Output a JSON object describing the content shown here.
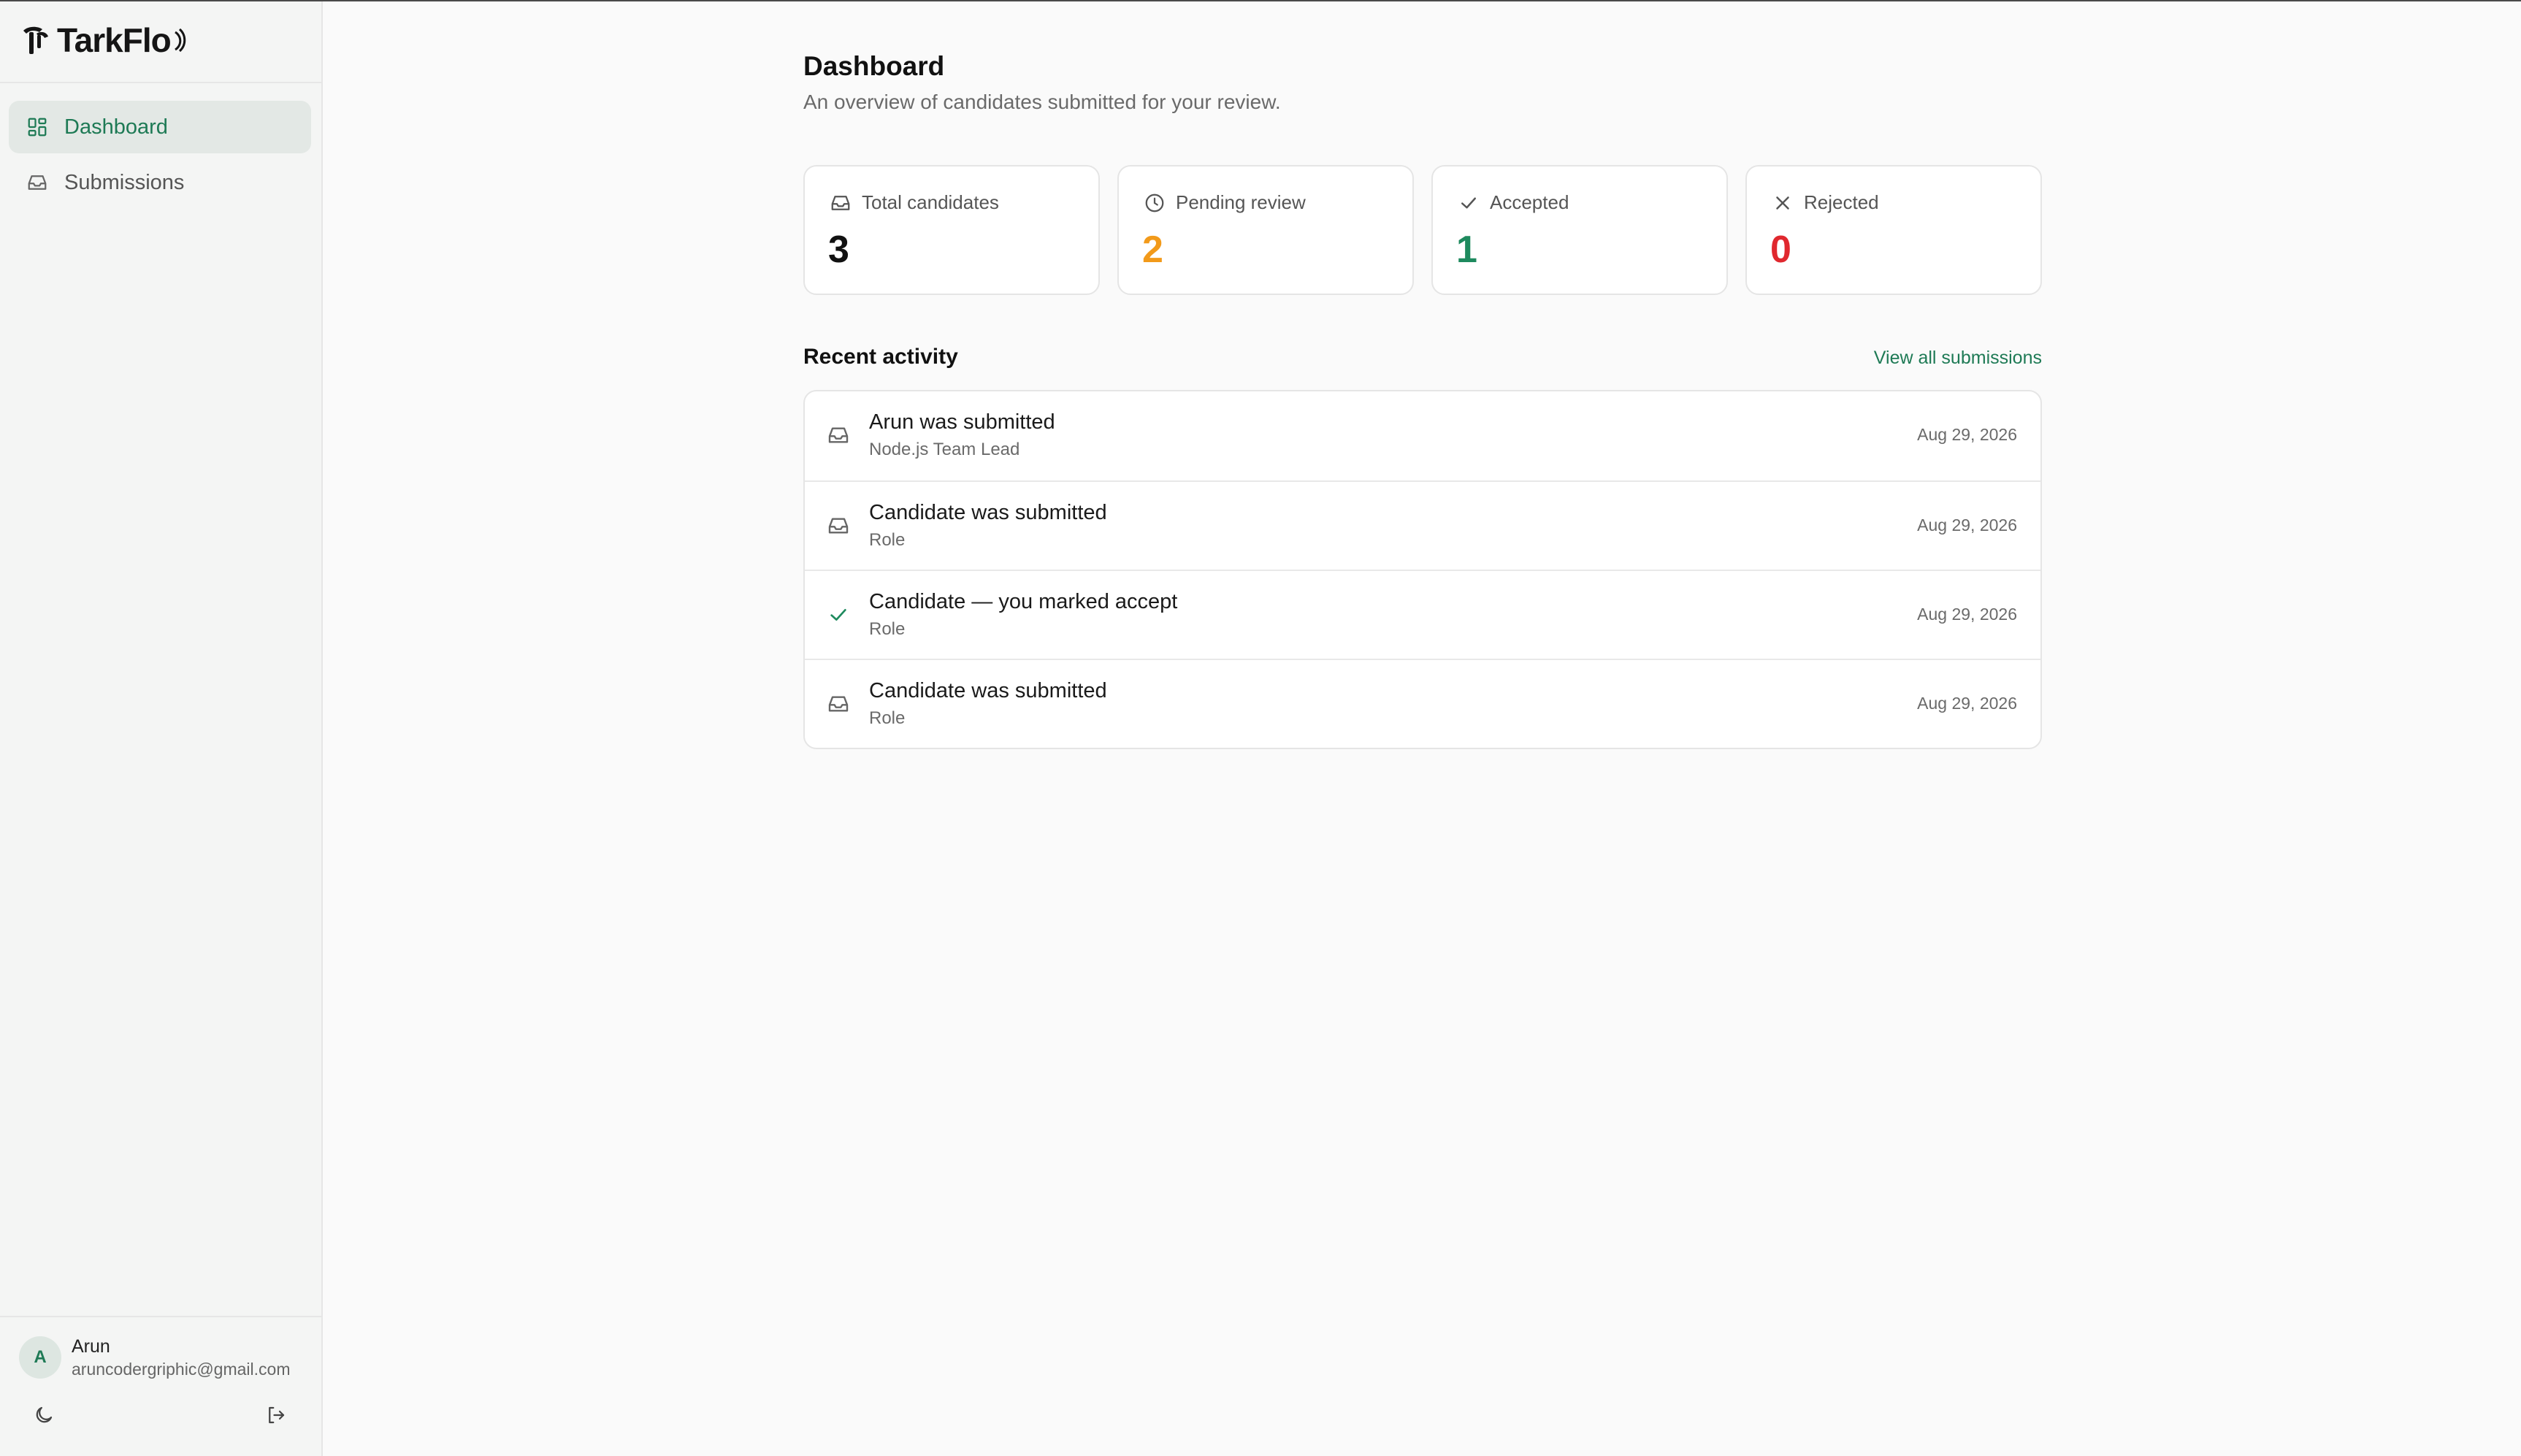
{
  "app": {
    "brand": "TarkFlo"
  },
  "colors": {
    "accent": "#1e7a55",
    "pending": "#f29a1a",
    "accepted": "#1e8a5e",
    "rejected": "#e0282e",
    "total": "#111111"
  },
  "sidebar": {
    "items": [
      {
        "label": "Dashboard",
        "icon": "dashboard-grid-icon",
        "active": true
      },
      {
        "label": "Submissions",
        "icon": "inbox-icon",
        "active": false
      }
    ],
    "user": {
      "initial": "A",
      "name": "Arun",
      "email": "aruncodergriphic@gmail.com"
    }
  },
  "header": {
    "title": "Dashboard",
    "subtitle": "An overview of candidates submitted for your review."
  },
  "stats": [
    {
      "label": "Total candidates",
      "value": "3",
      "icon": "inbox-icon"
    },
    {
      "label": "Pending review",
      "value": "2",
      "icon": "clock-icon"
    },
    {
      "label": "Accepted",
      "value": "1",
      "icon": "check-icon"
    },
    {
      "label": "Rejected",
      "value": "0",
      "icon": "x-icon"
    }
  ],
  "activity": {
    "title": "Recent activity",
    "view_all": "View all submissions",
    "rows": [
      {
        "title": "Arun was submitted",
        "subtitle": "Node.js Team Lead",
        "date": "Aug 29, 2026",
        "icon": "inbox-icon"
      },
      {
        "title": "Candidate was submitted",
        "subtitle": "Role",
        "date": "Aug 29, 2026",
        "icon": "inbox-icon"
      },
      {
        "title": "Candidate — you marked accept",
        "subtitle": "Role",
        "date": "Aug 29, 2026",
        "icon": "check-icon"
      },
      {
        "title": "Candidate was submitted",
        "subtitle": "Role",
        "date": "Aug 29, 2026",
        "icon": "inbox-icon"
      }
    ]
  }
}
